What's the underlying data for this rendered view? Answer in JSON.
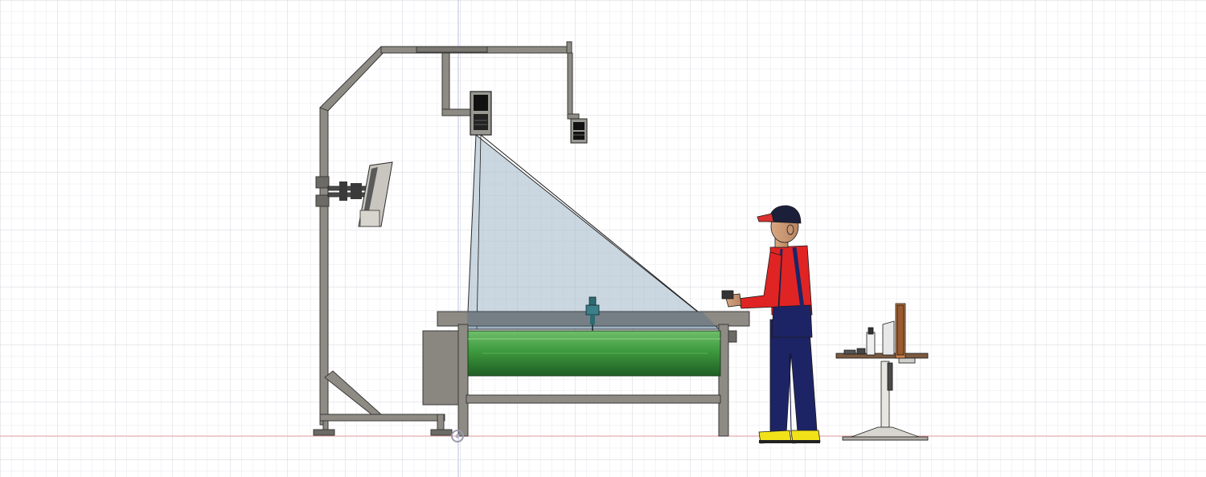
{
  "view": {
    "background": "#ffffff",
    "grid_minor_color": "#e9e9ef",
    "grid_major_color": "#d4d4de",
    "axis_horizontal_color": "#e8a0a0",
    "axis_vertical_color": "#b8c4e0"
  },
  "model": {
    "frame_color": "#8e8b84",
    "frame_edge_color": "#3a3a3a",
    "scan_cone_color": "#9fb6c6",
    "conveyor_belt_color": "#3d8f3d",
    "worker": {
      "helmet_color": "#1c1f3a",
      "cap_brim_color": "#d93030",
      "shirt_color": "#e02424",
      "overalls_color": "#1d2466",
      "shoe_color": "#f2e21a"
    }
  }
}
